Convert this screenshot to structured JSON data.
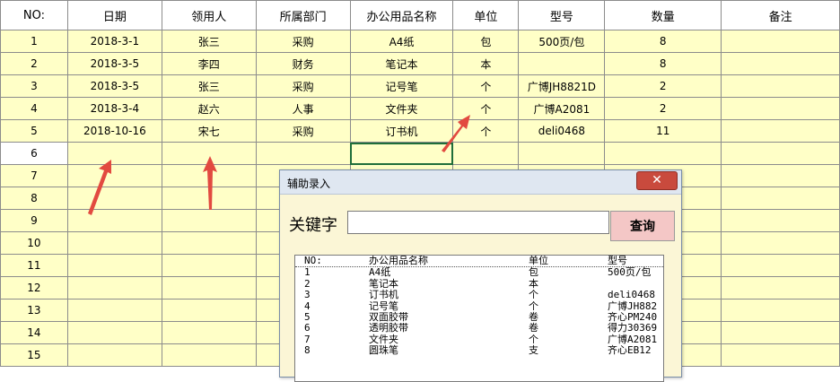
{
  "columns": [
    "NO:",
    "日期",
    "领用人",
    "所属部门",
    "办公用品名称",
    "单位",
    "型号",
    "数量",
    "备注"
  ],
  "rows": [
    {
      "no": "1",
      "date": "2018-3-1",
      "person": "张三",
      "dept": "采购",
      "item": "A4纸",
      "unit": "包",
      "model": "500页/包",
      "qty": "8",
      "note": ""
    },
    {
      "no": "2",
      "date": "2018-3-5",
      "person": "李四",
      "dept": "财务",
      "item": "笔记本",
      "unit": "本",
      "model": "",
      "qty": "8",
      "note": ""
    },
    {
      "no": "3",
      "date": "2018-3-5",
      "person": "张三",
      "dept": "采购",
      "item": "记号笔",
      "unit": "个",
      "model": "广博JH8821D",
      "qty": "2",
      "note": ""
    },
    {
      "no": "4",
      "date": "2018-3-4",
      "person": "赵六",
      "dept": "人事",
      "item": "文件夹",
      "unit": "个",
      "model": "广博A2081",
      "qty": "2",
      "note": ""
    },
    {
      "no": "5",
      "date": "2018-10-16",
      "person": "宋七",
      "dept": "采购",
      "item": "订书机",
      "unit": "个",
      "model": "deli0468",
      "qty": "11",
      "note": ""
    },
    {
      "no": "6",
      "date": "",
      "person": "",
      "dept": "",
      "item": "",
      "unit": "",
      "model": "",
      "qty": "",
      "note": ""
    },
    {
      "no": "7",
      "date": "",
      "person": "",
      "dept": "",
      "item": "",
      "unit": "",
      "model": "",
      "qty": "",
      "note": ""
    },
    {
      "no": "8",
      "date": "",
      "person": "",
      "dept": "",
      "item": "",
      "unit": "",
      "model": "",
      "qty": "",
      "note": ""
    },
    {
      "no": "9",
      "date": "",
      "person": "",
      "dept": "",
      "item": "",
      "unit": "",
      "model": "",
      "qty": "",
      "note": ""
    },
    {
      "no": "10",
      "date": "",
      "person": "",
      "dept": "",
      "item": "",
      "unit": "",
      "model": "",
      "qty": "",
      "note": ""
    },
    {
      "no": "11",
      "date": "",
      "person": "",
      "dept": "",
      "item": "",
      "unit": "",
      "model": "",
      "qty": "",
      "note": ""
    },
    {
      "no": "12",
      "date": "",
      "person": "",
      "dept": "",
      "item": "",
      "unit": "",
      "model": "",
      "qty": "",
      "note": ""
    },
    {
      "no": "13",
      "date": "",
      "person": "",
      "dept": "",
      "item": "",
      "unit": "",
      "model": "",
      "qty": "",
      "note": ""
    },
    {
      "no": "14",
      "date": "",
      "person": "",
      "dept": "",
      "item": "",
      "unit": "",
      "model": "",
      "qty": "",
      "note": ""
    },
    {
      "no": "15",
      "date": "",
      "person": "",
      "dept": "",
      "item": "",
      "unit": "",
      "model": "",
      "qty": "",
      "note": ""
    }
  ],
  "dialog": {
    "title": "辅助录入",
    "close_icon": "close-icon",
    "close_glyph": "✕",
    "keyword_label": "关键字",
    "keyword_value": "",
    "query_label": "查询",
    "list_header": [
      "NO:",
      "办公用品名称",
      "单位",
      "型号"
    ],
    "list_items": [
      [
        "1",
        "A4纸",
        "包",
        "500页/包"
      ],
      [
        "2",
        "笔记本",
        "本",
        ""
      ],
      [
        "3",
        "订书机",
        "个",
        "deli0468"
      ],
      [
        "4",
        "记号笔",
        "个",
        "广博JH882"
      ],
      [
        "5",
        "双面胶带",
        "卷",
        "齐心PM240"
      ],
      [
        "6",
        "透明胶带",
        "卷",
        "得力30369"
      ],
      [
        "7",
        "文件夹",
        "个",
        "广博A2081"
      ],
      [
        "8",
        "圆珠笔",
        "支",
        "齐心EB12"
      ]
    ]
  },
  "colors": {
    "cell_fill": "#ffffc7",
    "arrow": "#e24a40",
    "selection": "#1f6e3a",
    "dialog_bg": "#fbf6d6",
    "query_btn": "#f4c7c6",
    "close_btn": "#c94a3d"
  }
}
